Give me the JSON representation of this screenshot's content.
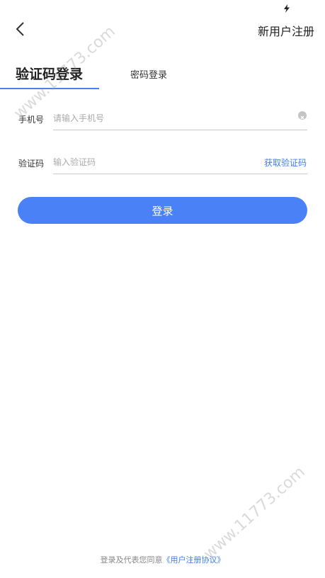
{
  "header": {
    "register_label": "新用户注册"
  },
  "icons": {
    "back": "chevron-left-icon",
    "status": "lightning-icon",
    "clear": "clear-circle-icon"
  },
  "tabs": {
    "sms_label": "验证码登录",
    "password_label": "密码登录",
    "active": "sms"
  },
  "form": {
    "phone": {
      "label": "手机号",
      "placeholder": "请输入手机号",
      "value": ""
    },
    "code": {
      "label": "验证码",
      "placeholder": "输入验证码",
      "value": "",
      "get_code_label": "获取验证码"
    },
    "login_label": "登录"
  },
  "footer": {
    "prefix": "登录及代表您同意",
    "agreement": "《用户注册协议》"
  },
  "watermark": "www.11773.com",
  "colors": {
    "accent": "#4b81f6",
    "link": "#3f7cf0"
  }
}
